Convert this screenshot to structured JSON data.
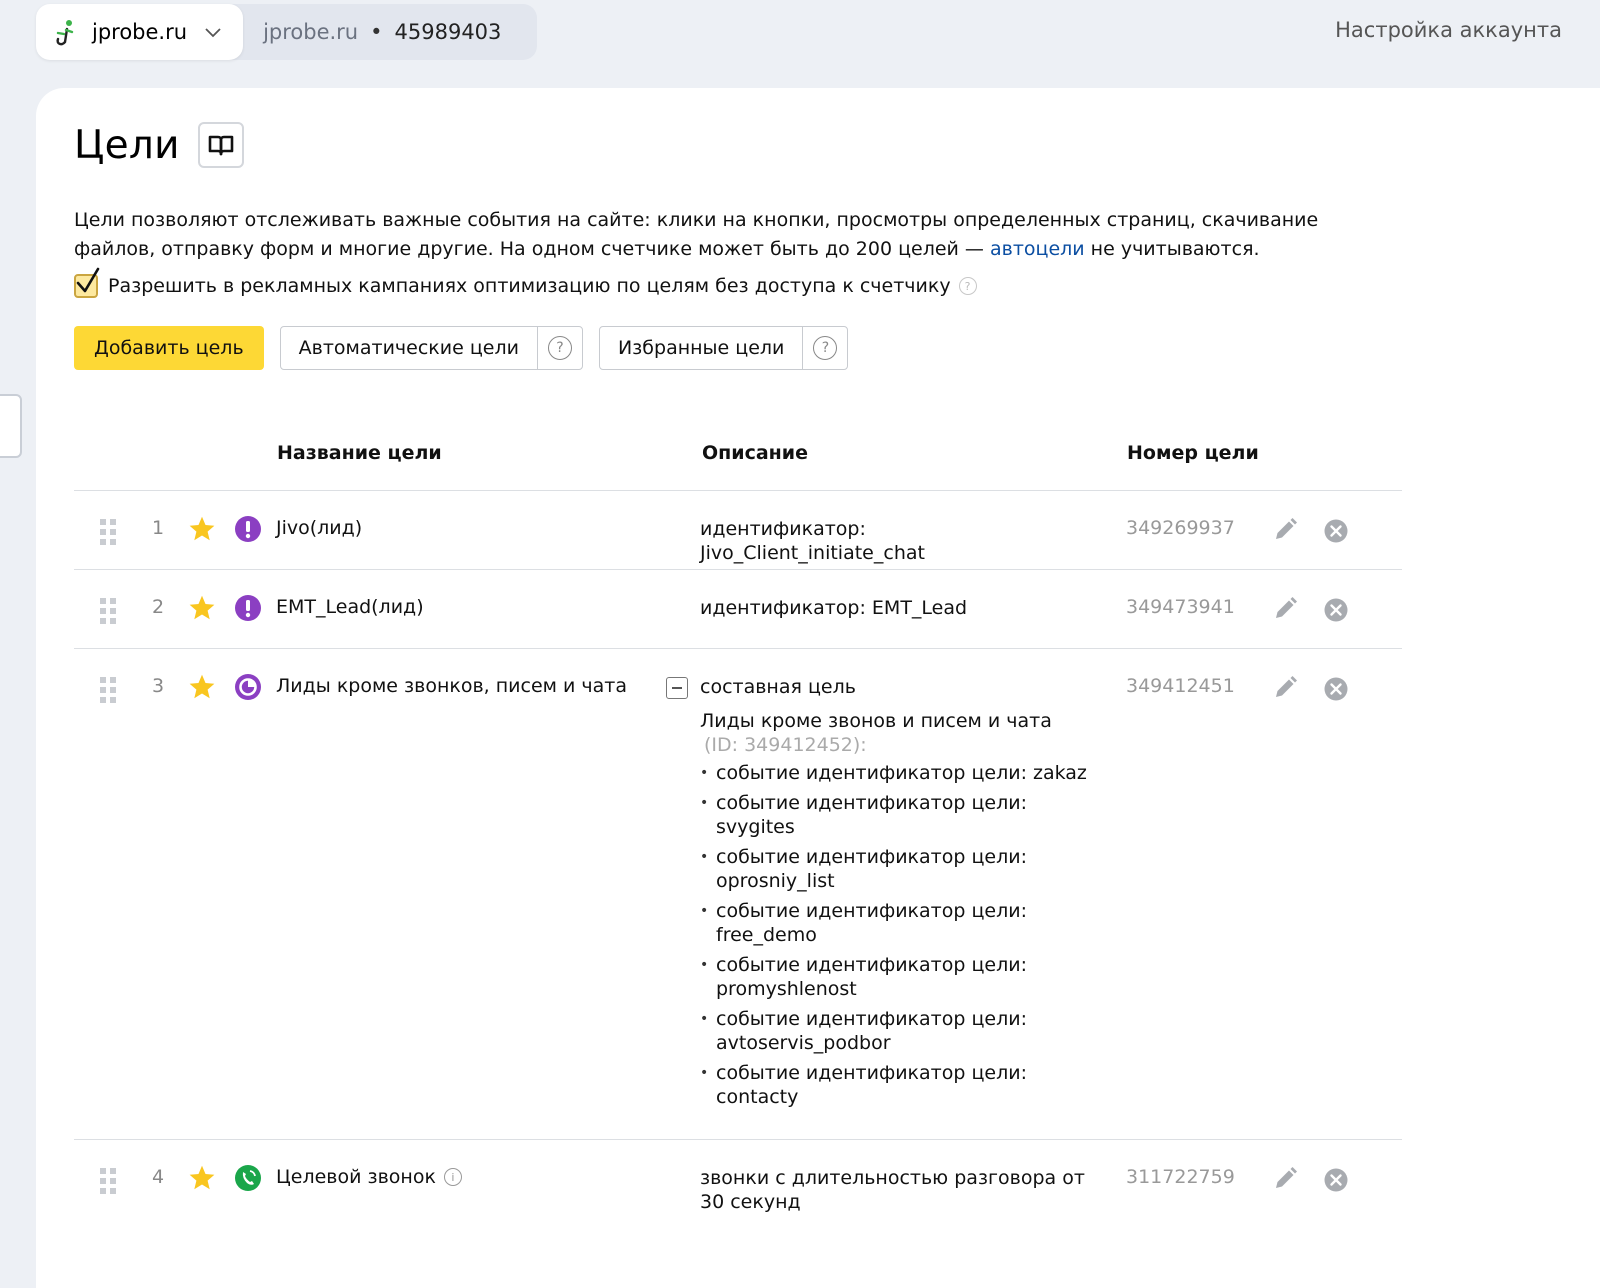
{
  "header": {
    "site_name": "jprobe.ru",
    "counter_name": "jprobe.ru",
    "counter_separator": "•",
    "counter_id": "45989403",
    "account_settings": "Настройка аккаунта"
  },
  "page": {
    "title": "Цели",
    "intro_text_1": "Цели позволяют отслеживать важные события на сайте: клики на кнопки, просмотры определенных страниц, скачивание файлов, отправку форм и многие другие. На одном счетчике может быть до 200 целей — ",
    "intro_link": "автоцели",
    "intro_text_2": " не учитываются.",
    "allow_checkbox_label": "Разрешить в рекламных кампаниях оптимизацию по целям без доступа к счетчику",
    "allow_checked": true,
    "help_glyph": "?"
  },
  "buttons": {
    "add_goal": "Добавить цель",
    "auto_goals": "Автоматические цели",
    "favorite_goals": "Избранные цели"
  },
  "table": {
    "columns": {
      "name": "Название цели",
      "description": "Описание",
      "number": "Номер цели"
    },
    "rows": [
      {
        "num": "1",
        "icon": "exclamation-icon",
        "icon_color": "#8b3fc2",
        "name": "Jivo(лид)",
        "description": "идентификатор: Jivo_Client_initiate_chat",
        "goal_id": "349269937"
      },
      {
        "num": "2",
        "icon": "exclamation-icon",
        "icon_color": "#8b3fc2",
        "name": "EMT_Lead(лид)",
        "description": "идентификатор: EMT_Lead",
        "goal_id": "349473941"
      },
      {
        "num": "3",
        "icon": "composite-icon",
        "icon_color": "#8b3fc2",
        "name": "Лиды кроме звонков, писем и чата",
        "description": "составная цель",
        "goal_id": "349412451",
        "sub_title": "Лиды кроме звонов и писем и чата",
        "sub_id": "(ID: 349412452):",
        "sub_items": [
          "событие идентификатор цели: zakaz",
          "событие идентификатор цели: svygites",
          "событие идентификатор цели: oprosniy_list",
          "событие идентификатор цели: free_demo",
          "событие идентификатор цели: promyshlenost",
          "событие идентификатор цели: avtoservis_podbor",
          "событие идентификатор цели: contacty"
        ]
      },
      {
        "num": "4",
        "icon": "phone-icon",
        "icon_color": "#1aa64a",
        "name": "Целевой звонок",
        "info_glyph": "i",
        "description": "звонки с длительностью разговора от 30 секунд",
        "goal_id": "311722759"
      }
    ]
  },
  "colors": {
    "accent_yellow": "#fdd835",
    "star": "#f9c620",
    "link": "#0b4ea2"
  }
}
